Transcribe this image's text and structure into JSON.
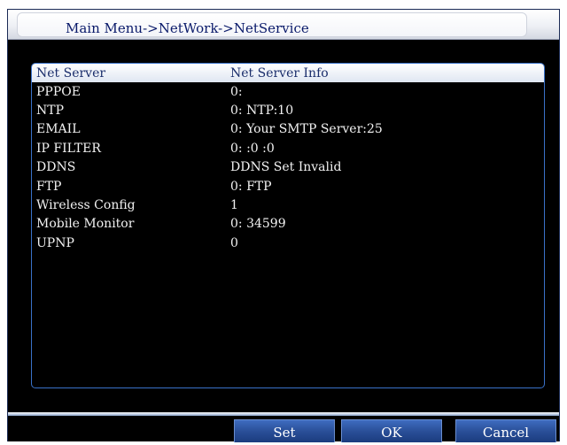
{
  "window": {
    "title": "Main Menu->NetWork->NetService"
  },
  "table": {
    "headers": [
      "Net Server",
      "Net Server Info"
    ],
    "rows": [
      {
        "name": "PPPOE",
        "info": "0:"
      },
      {
        "name": "NTP",
        "info": "0: NTP:10"
      },
      {
        "name": "EMAIL",
        "info": "0: Your SMTP Server:25"
      },
      {
        "name": "IP FILTER",
        "info": "0: :0 :0"
      },
      {
        "name": "DDNS",
        "info": "DDNS Set Invalid"
      },
      {
        "name": "FTP",
        "info": "0: FTP"
      },
      {
        "name": "Wireless Config",
        "info": "1"
      },
      {
        "name": "Mobile Monitor",
        "info": "0: 34599"
      },
      {
        "name": "UPNP",
        "info": "0"
      }
    ]
  },
  "buttons": {
    "set": "Set",
    "ok": "OK",
    "cancel": "Cancel"
  },
  "colors": {
    "background": "#000000",
    "title_text": "#0a1a6a",
    "panel_border": "#3a72c9",
    "button": "#2a4f98"
  }
}
